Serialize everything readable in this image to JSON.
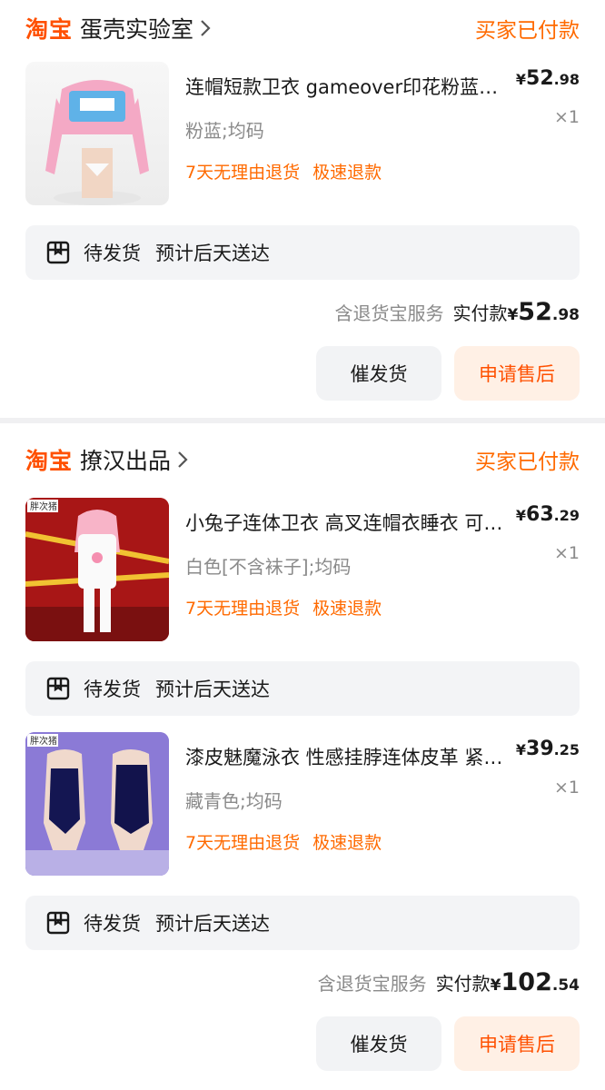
{
  "orders": [
    {
      "platform": "淘宝",
      "shop_name": "蛋壳实验室",
      "status": "买家已付款",
      "items": [
        {
          "title": "连帽短款卫衣 gameover印花粉蓝撞色 JK制服上衣",
          "spec": "粉蓝;均码",
          "tags": [
            "7天无理由退货",
            "极速退款"
          ],
          "price_yen": "¥",
          "price_int": "52",
          "price_dec": ".98",
          "qty": "×1",
          "ship_status": "待发货",
          "ship_eta": "预计后天送达",
          "thumb_label": ""
        }
      ],
      "service": "含退货宝服务",
      "total_label": "实付款",
      "total_yen": "¥",
      "total_int": "52",
      "total_dec": ".98",
      "btn_urge": "催发货",
      "btn_after": "申请售后"
    },
    {
      "platform": "淘宝",
      "shop_name": "撩汉出品",
      "status": "买家已付款",
      "items": [
        {
          "title": "小兔子连体卫衣 高叉连帽衣睡衣 可爱粉白",
          "spec": "白色[不含袜子];均码",
          "tags": [
            "7天无理由退货",
            "极速退款"
          ],
          "price_yen": "¥",
          "price_int": "63",
          "price_dec": ".29",
          "qty": "×1",
          "ship_status": "待发货",
          "ship_eta": "预计后天送达",
          "thumb_label": "胖次猪"
        },
        {
          "title": "漆皮魅魔泳衣 性感挂脖连体皮革 紧身衣",
          "spec": "藏青色;均码",
          "tags": [
            "7天无理由退货",
            "极速退款"
          ],
          "price_yen": "¥",
          "price_int": "39",
          "price_dec": ".25",
          "qty": "×1",
          "ship_status": "待发货",
          "ship_eta": "预计后天送达",
          "thumb_label": "胖次猪"
        }
      ],
      "service": "含退货宝服务",
      "total_label": "实付款",
      "total_yen": "¥",
      "total_int": "102",
      "total_dec": ".54",
      "btn_urge": "催发货",
      "btn_after": "申请售后"
    }
  ],
  "colors": {
    "brand_orange": "#ff5000",
    "status_orange": "#ff6a00",
    "muted_gray": "#8a8a8a",
    "after_sale_bg": "#fff0e5"
  }
}
